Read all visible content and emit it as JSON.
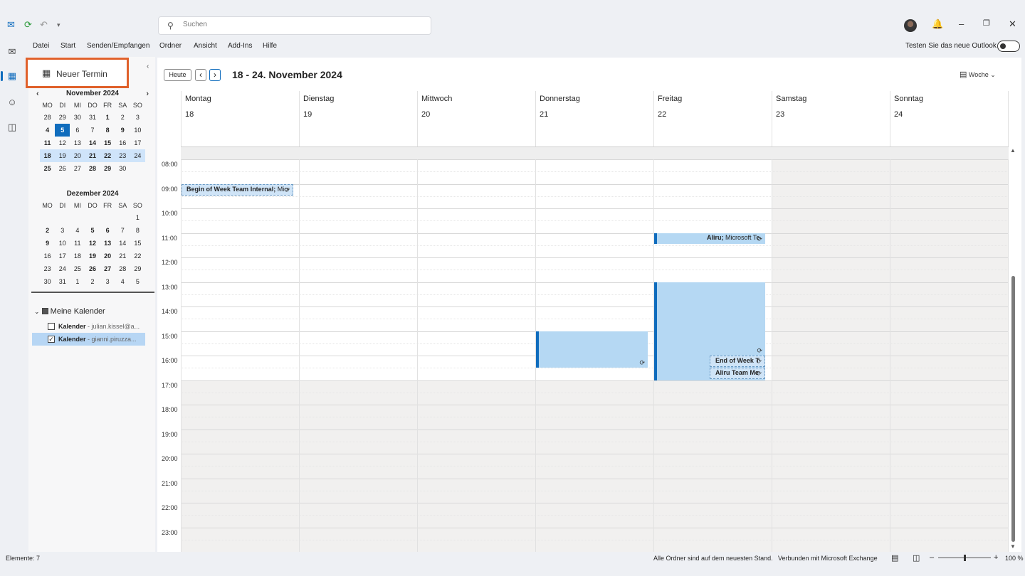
{
  "titlebar": {
    "search_placeholder": "Suchen"
  },
  "menu": [
    "Datei",
    "Start",
    "Senden/Empfangen",
    "Ordner",
    "Ansicht",
    "Add-Ins",
    "Hilfe"
  ],
  "new_outlook_label": "Testen Sie das neue Outlook",
  "new_event_label": "Neuer Termin",
  "mini_nov": {
    "title": "November 2024",
    "weekdays": [
      "MO",
      "DI",
      "MI",
      "DO",
      "FR",
      "SA",
      "SO"
    ],
    "weeks": [
      [
        "28",
        "29",
        "30",
        "31",
        "1",
        "2",
        "3"
      ],
      [
        "4",
        "5",
        "6",
        "7",
        "8",
        "9",
        "10"
      ],
      [
        "11",
        "12",
        "13",
        "14",
        "15",
        "16",
        "17"
      ],
      [
        "18",
        "19",
        "20",
        "21",
        "22",
        "23",
        "24"
      ],
      [
        "25",
        "26",
        "27",
        "28",
        "29",
        "30",
        ""
      ]
    ]
  },
  "mini_dec": {
    "title": "Dezember 2024",
    "weekdays": [
      "MO",
      "DI",
      "MI",
      "DO",
      "FR",
      "SA",
      "SO"
    ],
    "weeks": [
      [
        "",
        "",
        "",
        "",
        "",
        "",
        "1"
      ],
      [
        "2",
        "3",
        "4",
        "5",
        "6",
        "7",
        "8"
      ],
      [
        "9",
        "10",
        "11",
        "12",
        "13",
        "14",
        "15"
      ],
      [
        "16",
        "17",
        "18",
        "19",
        "20",
        "21",
        "22"
      ],
      [
        "23",
        "24",
        "25",
        "26",
        "27",
        "28",
        "29"
      ],
      [
        "30",
        "31",
        "1",
        "2",
        "3",
        "4",
        "5"
      ]
    ]
  },
  "calendars": {
    "group": "Meine Kalender",
    "items": [
      {
        "name": "Kalender",
        "account": " - julian.kissel@a...",
        "checked": false
      },
      {
        "name": "Kalender",
        "account": " - gianni.piruzza...",
        "checked": true
      }
    ]
  },
  "toolbar": {
    "today": "Heute",
    "prev": "‹",
    "next": "›",
    "range": "18 - 24. November 2024",
    "view": "Woche"
  },
  "days": [
    {
      "name": "Montag",
      "date": "18"
    },
    {
      "name": "Dienstag",
      "date": "19"
    },
    {
      "name": "Mittwoch",
      "date": "20"
    },
    {
      "name": "Donnerstag",
      "date": "21"
    },
    {
      "name": "Freitag",
      "date": "22"
    },
    {
      "name": "Samstag",
      "date": "23"
    },
    {
      "name": "Sonntag",
      "date": "24"
    }
  ],
  "hours": [
    "08:00",
    "09:00",
    "10:00",
    "11:00",
    "12:00",
    "13:00",
    "14:00",
    "15:00",
    "16:00",
    "17:00",
    "18:00",
    "19:00",
    "20:00",
    "21:00",
    "22:00",
    "23:00"
  ],
  "events": {
    "mon_0900": {
      "title": "Begin of Week Team Internal;",
      "detail": " Micr"
    },
    "fri_1100": {
      "title": "Aliru;",
      "detail": " Microsoft Te"
    },
    "fri_1600a": {
      "title": "End of Week T"
    },
    "fri_1630": {
      "title": "Aliru Team Me"
    }
  },
  "status": {
    "items": "Elemente: 7",
    "sync": "Alle Ordner sind auf dem neuesten Stand.",
    "connection": "Verbunden mit Microsoft Exchange",
    "zoom": "100 %"
  },
  "colors": {
    "accent": "#0f6cbd",
    "event_fill": "#b5d8f3",
    "highlight": "#e0612b"
  }
}
